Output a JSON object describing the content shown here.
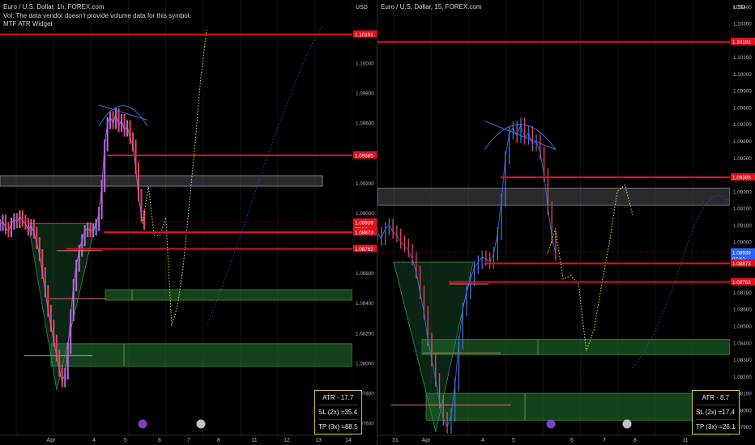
{
  "colors": {
    "background": "#000000",
    "candles": "#4a6fd8",
    "candles_left": "#b86be0",
    "level_line": "#e0101c",
    "zone_green": "#1c5a22",
    "zone_gray": "#5b5e66",
    "ellipse": "#d9534f",
    "projection": "#e8e04a",
    "price_tag_red": "#e0101c",
    "price_tag_blue": "#2962ff",
    "atr_border": "#d8c74a"
  },
  "left": {
    "legend": [
      "Euro / U.S. Dollar, 1h, FOREX.com",
      "Vol: The data vendor doesn't provide volume data for this symbol.",
      "MTF ATR Widget"
    ],
    "axis_unit": "USD",
    "y_ticks": [
      "1.10191",
      "1.10000",
      "1.09800",
      "1.09600",
      "1.09385",
      "1.09200",
      "1.09000",
      "1.08939",
      "07:52",
      "1.08873",
      "1.08762",
      "1.08600",
      "1.08400",
      "1.08200",
      "1.08000",
      "1.07800",
      "1.07600"
    ],
    "x_ticks": [
      "Apr",
      "4",
      "5",
      "6",
      "7",
      "8",
      "11",
      "12",
      "13",
      "14"
    ],
    "atr": [
      "ATR - 17.7",
      "SL (2x) =35.4",
      "TP (3x) =88.5"
    ]
  },
  "right": {
    "legend": [
      "Euro / U.S. Dollar, 15, FOREX.com"
    ],
    "axis_unit": "USD",
    "y_ticks": [
      "1.10400",
      "1.10300",
      "1.10191",
      "1.10100",
      "1.10000",
      "1.09900",
      "1.09800",
      "1.09700",
      "1.09600",
      "1.09500",
      "1.09385",
      "1.09300",
      "1.09200",
      "1.09100",
      "1.09000",
      "1.08939",
      "07:52",
      "1.08873",
      "1.08762",
      "1.08700",
      "1.08600",
      "1.08500",
      "1.08400",
      "1.08300",
      "1.08200",
      "1.08100",
      "1.08000",
      "1.07900"
    ],
    "x_ticks": [
      "31",
      "Apr",
      "4",
      "5",
      "6",
      "7",
      "8",
      "11"
    ],
    "atr": [
      "ATR - 8.7",
      "SL (2x) =17.4",
      "TP (3x) =26.1"
    ]
  },
  "chart_data": [
    {
      "type": "line",
      "title": "Euro / U.S. Dollar, 1h, FOREX.com",
      "ylabel": "USD",
      "ylim": [
        1.0752,
        1.1042
      ],
      "levels": [
        1.10191,
        1.09385,
        1.08873,
        1.08762
      ],
      "current_price": 1.08939,
      "countdown": "07:52",
      "x_ticks": [
        "Apr",
        "4",
        "5",
        "6",
        "7",
        "8",
        "11",
        "12",
        "13",
        "14"
      ],
      "y": [
        1.0892,
        1.0895,
        1.089,
        1.0888,
        1.0893,
        1.0896,
        1.0894,
        1.0898,
        1.0895,
        1.0893,
        1.0889,
        1.0892,
        1.0887,
        1.088,
        1.0872,
        1.086,
        1.0848,
        1.0835,
        1.0825,
        1.0815,
        1.0805,
        1.0795,
        1.0788,
        1.0793,
        1.081,
        1.0832,
        1.0852,
        1.0865,
        1.0875,
        1.0882,
        1.0888,
        1.089,
        1.0888,
        1.0889,
        1.0892,
        1.09,
        1.0918,
        1.0945,
        1.096,
        1.0964,
        1.096,
        1.0966,
        1.0958,
        1.0962,
        1.0955,
        1.0958,
        1.095,
        1.0945,
        1.093,
        1.0912,
        1.0898,
        1.0893
      ],
      "projection": [
        1.0893,
        1.0918,
        1.0885,
        1.0885,
        1.0897,
        1.0825,
        1.0838,
        1.0865,
        1.0905,
        1.0945,
        1.099,
        1.1022
      ]
    },
    {
      "type": "line",
      "title": "Euro / U.S. Dollar, 15, FOREX.com",
      "ylabel": "USD",
      "ylim": [
        1.0785,
        1.1044
      ],
      "levels": [
        1.10191,
        1.09385,
        1.08873,
        1.08762
      ],
      "current_price": 1.08939,
      "countdown": "07:52",
      "x_ticks": [
        "31",
        "Apr",
        "4",
        "5",
        "6",
        "7",
        "8",
        "11"
      ],
      "y": [
        1.0905,
        1.0902,
        1.0908,
        1.091,
        1.0906,
        1.0904,
        1.09,
        1.0898,
        1.0895,
        1.089,
        1.0882,
        1.087,
        1.0858,
        1.0842,
        1.083,
        1.0818,
        1.0805,
        1.0795,
        1.079,
        1.0797,
        1.0815,
        1.084,
        1.086,
        1.087,
        1.0878,
        1.0885,
        1.0888,
        1.0891,
        1.089,
        1.0888,
        1.0893,
        1.0905,
        1.0925,
        1.095,
        1.0965,
        1.0968,
        1.0963,
        1.097,
        1.0962,
        1.0965,
        1.0958,
        1.096,
        1.0953,
        1.094,
        1.092,
        1.0903,
        1.0893
      ],
      "projection": [
        1.0893,
        1.0908,
        1.0878,
        1.088,
        1.0875,
        1.0835,
        1.0848,
        1.0875,
        1.09,
        1.093,
        1.0934,
        1.0916
      ]
    }
  ]
}
